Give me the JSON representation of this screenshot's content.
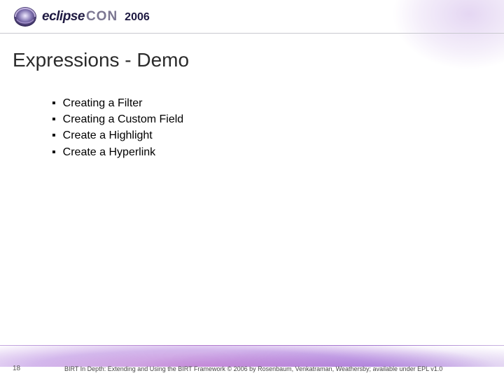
{
  "header": {
    "brand_eclipse": "eclipse",
    "brand_con": "CON",
    "year": "2006"
  },
  "slide": {
    "title": "Expressions - Demo",
    "bullets": [
      "Creating a Filter",
      "Creating a Custom Field",
      "Create a Highlight",
      "Create a Hyperlink"
    ]
  },
  "footer": {
    "page_number": "18",
    "copyright": "BIRT In Depth: Extending and Using the BIRT Framework © 2006 by Rosenbaum, Venkatraman, Weathersby; available under EPL v1.0"
  }
}
